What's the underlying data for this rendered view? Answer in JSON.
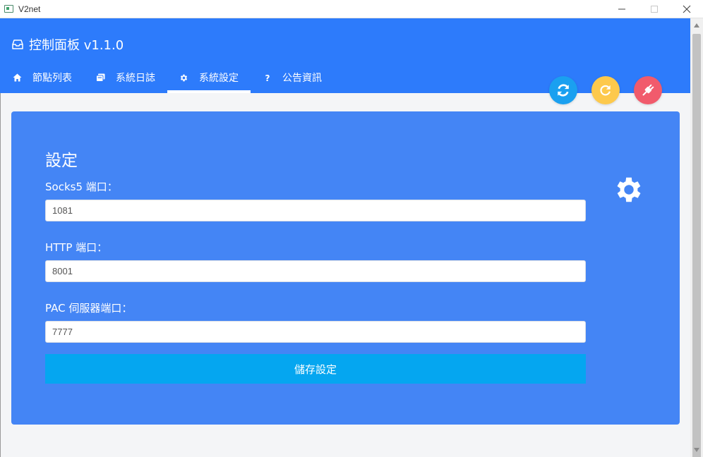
{
  "window": {
    "title": "V2net"
  },
  "header": {
    "title": "控制面板 v1.1.0",
    "tabs": [
      {
        "label": "節點列表",
        "icon": "home-icon"
      },
      {
        "label": "系統日誌",
        "icon": "copy-icon"
      },
      {
        "label": "系統設定",
        "icon": "gear-icon",
        "active": true
      },
      {
        "label": "公告資訊",
        "icon": "question-icon"
      }
    ],
    "actions": [
      {
        "icon": "sync-icon",
        "color": "#1aa0f0"
      },
      {
        "icon": "refresh-icon",
        "color": "#fdc94c"
      },
      {
        "icon": "plug-icon",
        "color": "#f15b6c"
      }
    ]
  },
  "settings": {
    "title": "設定",
    "socks5_label": "Socks5 端口：",
    "socks5_value": "1081",
    "http_label": "HTTP 端口：",
    "http_value": "8001",
    "pac_label": "PAC 伺服器端口：",
    "pac_value": "7777",
    "save_label": "儲存設定"
  },
  "colors": {
    "header": "#2d7bfb",
    "card": "#4485f5",
    "save_button": "#05a6f0"
  }
}
